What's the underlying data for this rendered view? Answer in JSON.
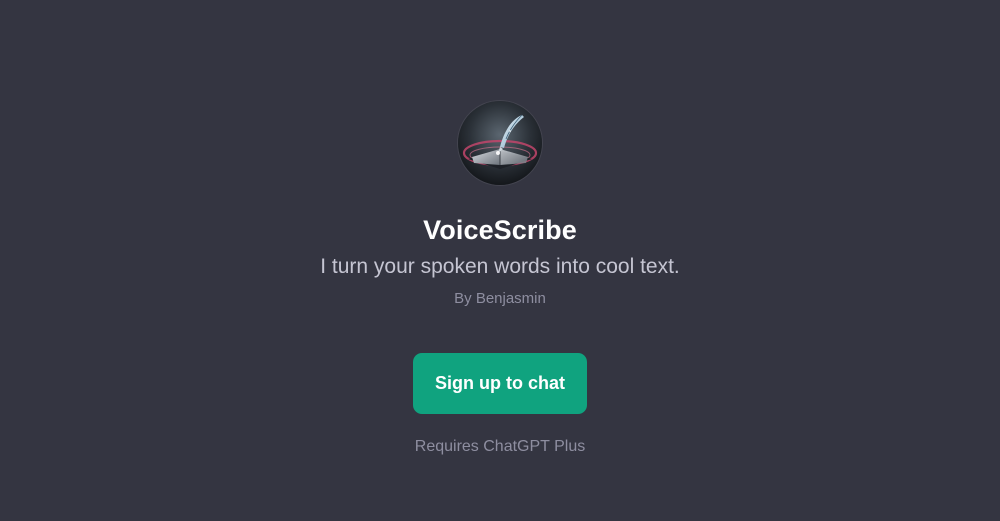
{
  "gpt": {
    "name": "VoiceScribe",
    "description": "I turn your spoken words into cool text.",
    "author": "By Benjasmin",
    "avatar_icon": "quill-on-book-icon"
  },
  "actions": {
    "signup_label": "Sign up to chat"
  },
  "footer": {
    "requirement": "Requires ChatGPT Plus"
  },
  "colors": {
    "background": "#343541",
    "accent": "#10a37f",
    "title": "#ffffff",
    "subtitle": "#c5c5d2",
    "muted": "#8e8ea0"
  }
}
